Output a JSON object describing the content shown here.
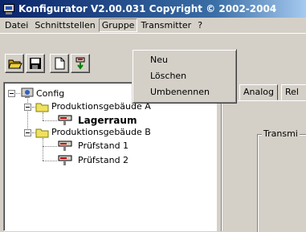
{
  "window": {
    "title": "Konfigurator  V2.00.031 Copyright © 2002-2004",
    "icon": "monitor-app-icon"
  },
  "menubar": {
    "items": [
      "Datei",
      "Schnittstellen",
      "Gruppe",
      "Transmitter",
      "?"
    ],
    "open_item": "Gruppe"
  },
  "dropdown": {
    "items": [
      "Neu",
      "Löschen",
      "Umbenennen"
    ]
  },
  "toolbar": {
    "buttons": [
      "open-folder-icon",
      "save-disk-icon",
      "new-document-icon",
      "transmitter-icon"
    ]
  },
  "tree": {
    "root": "Config",
    "groups": [
      {
        "label": "Produktionsgebäude A",
        "children": [
          {
            "label": "Lagerraum",
            "selected": true
          }
        ]
      },
      {
        "label": "Produktionsgebäude B",
        "children": [
          {
            "label": "Prüfstand 1"
          },
          {
            "label": "Prüfstand 2"
          }
        ]
      }
    ]
  },
  "tabs": [
    "Analog",
    "Rel"
  ],
  "panel": {
    "group_label": "Transmi"
  }
}
